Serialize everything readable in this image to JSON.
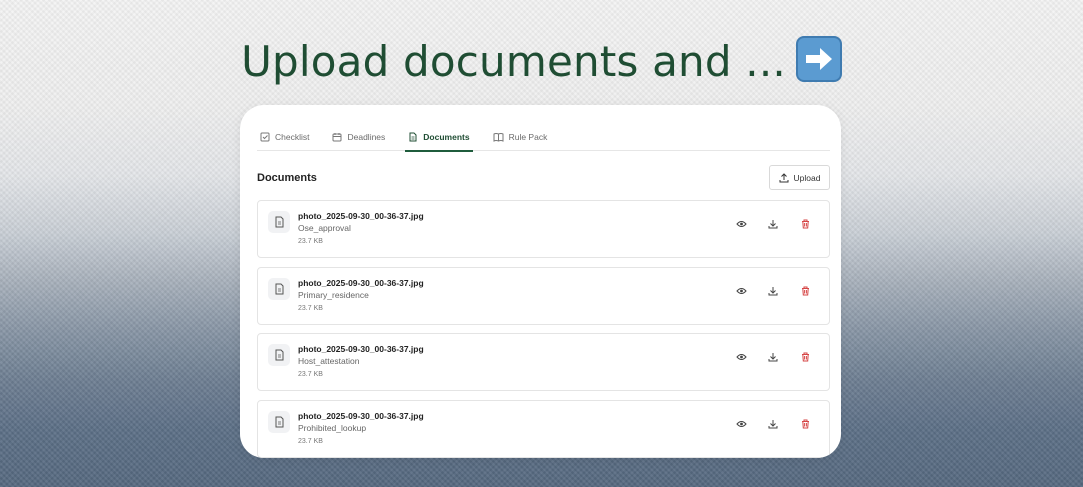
{
  "headline": {
    "text": "Upload documents and ...",
    "arrow_icon": "right-arrow-emoji"
  },
  "tabs": [
    {
      "label": "Checklist",
      "icon": "checkbox-icon",
      "active": false
    },
    {
      "label": "Deadlines",
      "icon": "calendar-icon",
      "active": false
    },
    {
      "label": "Documents",
      "icon": "document-icon",
      "active": true
    },
    {
      "label": "Rule Pack",
      "icon": "book-icon",
      "active": false
    }
  ],
  "section": {
    "title": "Documents",
    "upload_label": "Upload"
  },
  "documents": [
    {
      "filename": "photo_2025-09-30_00-36-37.jpg",
      "tag": "Ose_approval",
      "size": "23.7 KB"
    },
    {
      "filename": "photo_2025-09-30_00-36-37.jpg",
      "tag": "Primary_residence",
      "size": "23.7 KB"
    },
    {
      "filename": "photo_2025-09-30_00-36-37.jpg",
      "tag": "Host_attestation",
      "size": "23.7 KB"
    },
    {
      "filename": "photo_2025-09-30_00-36-37.jpg",
      "tag": "Prohibited_lookup",
      "size": "23.7 KB"
    }
  ],
  "colors": {
    "accent": "#1f5c3c",
    "delete": "#d64545"
  }
}
